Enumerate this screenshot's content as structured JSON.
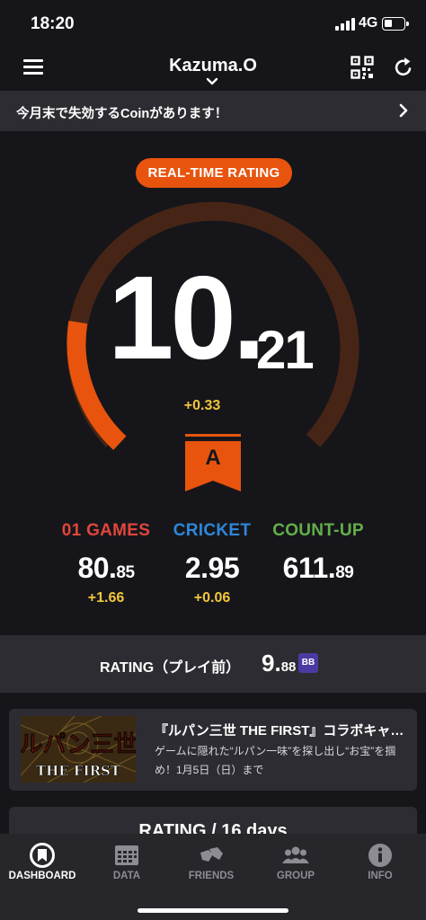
{
  "status_bar": {
    "time": "18:20",
    "network": "4G"
  },
  "nav": {
    "title": "Kazuma.O"
  },
  "banner": {
    "text": "今月末で失効するCoinがあります！"
  },
  "rating": {
    "pill_label": "REAL-TIME RATING",
    "value_int": "10.",
    "value_dec": "21",
    "change": "+0.33",
    "rank": "A",
    "gauge_fraction": 0.21,
    "accent_color": "#e8540e"
  },
  "stats": [
    {
      "label": "01 GAMES",
      "value_int": "80.",
      "value_dec": "85",
      "change": "+1.66",
      "color": "#e0463c"
    },
    {
      "label": "CRICKET",
      "value_int": "2.95",
      "value_dec": "",
      "change": "+0.06",
      "color": "#2f87d8"
    },
    {
      "label": "COUNT-UP",
      "value_int": "611.",
      "value_dec": "89",
      "change": "",
      "color": "#62b04a"
    }
  ],
  "previous": {
    "label": "RATING（プレイ前）",
    "value_int": "9.",
    "value_dec": "88",
    "badge": "BB"
  },
  "campaign": {
    "title": "『ルパン三世 THE FIRST』コラボキャン…",
    "description": "ゲームに隠れた“ルパン一味”を探し出し“お宝”を掴め！1月5日（日）まで",
    "image_text_top": "ルパン三世",
    "image_text_bottom": "THE FIRST"
  },
  "section": {
    "title": "RATING / 16 days"
  },
  "tabs": [
    {
      "label": "DASHBOARD",
      "icon": "dashboard-icon"
    },
    {
      "label": "DATA",
      "icon": "data-icon"
    },
    {
      "label": "FRIENDS",
      "icon": "friends-icon"
    },
    {
      "label": "GROUP",
      "icon": "group-icon"
    },
    {
      "label": "INFO",
      "icon": "info-icon"
    }
  ]
}
